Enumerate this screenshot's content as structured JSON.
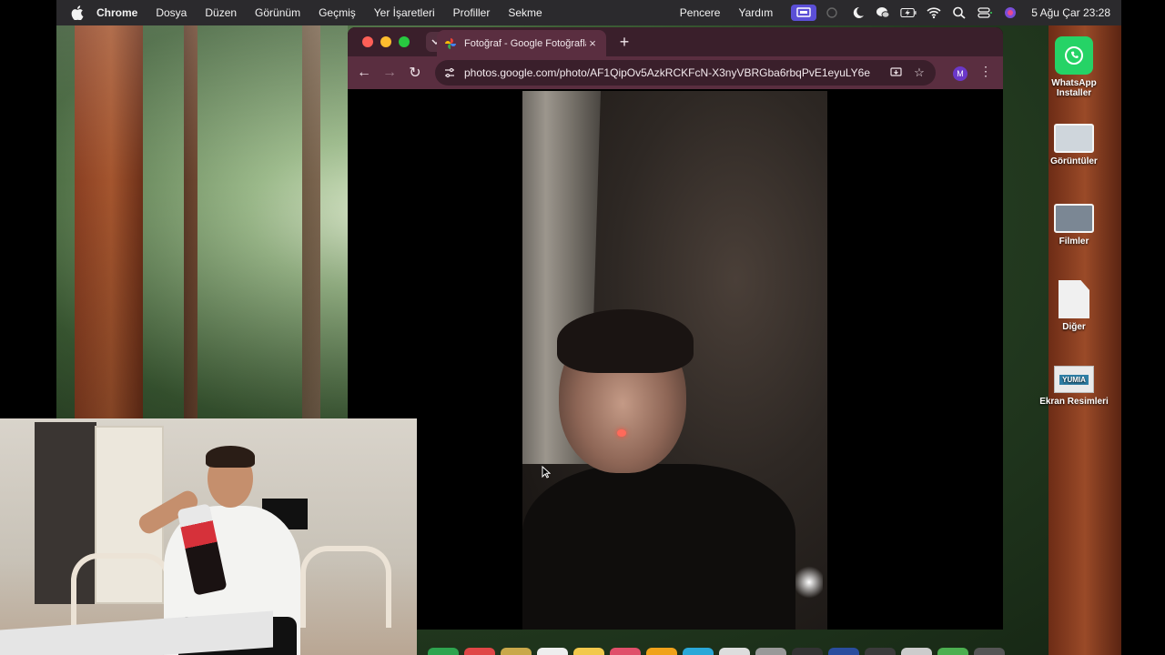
{
  "menubar": {
    "app_name": "Chrome",
    "menus": [
      "Dosya",
      "Düzen",
      "Görünüm",
      "Geçmiş",
      "Yer İşaretleri",
      "Profiller",
      "Sekme"
    ],
    "right_menus": [
      "Pencere",
      "Yardım"
    ],
    "clock": "5 Ağu Çar  23:28",
    "icons": [
      "screen-mirroring-icon",
      "focus-moon-icon",
      "wechat-icon",
      "battery-charging-icon",
      "wifi-icon",
      "spotlight-search-icon",
      "control-center-icon",
      "siri-icon"
    ]
  },
  "browser": {
    "tab": {
      "title": "Fotoğraf - Google Fotoğraflar",
      "close_glyph": "×"
    },
    "new_tab_glyph": "+",
    "url": "photos.google.com/photo/AF1QipOv5AzkRCKFcN-X3nyVBRGba6rbqPvE1eyuLY6e",
    "profile_initial": "M",
    "back_glyph": "←",
    "forward_glyph": "→",
    "reload_glyph": "↻",
    "menu_glyph": "⋮",
    "star_glyph": "☆"
  },
  "desktop": {
    "icons": [
      {
        "label": "WhatsApp Installer"
      },
      {
        "label": "Görüntüler"
      },
      {
        "label": "Filmler"
      },
      {
        "label": "Diğer"
      },
      {
        "label": "Ekran Resimleri"
      }
    ],
    "yumia_text": "YUMIA"
  },
  "colors": {
    "menubar": "#2b2a2d",
    "tabbar": "#3a1f2b",
    "toolbar": "#5a2e40",
    "accent_profile": "#6b38c9",
    "whatsapp": "#25d366"
  },
  "dock": {
    "item_colors": [
      "#2ea44f",
      "#e04646",
      "#c9a84a",
      "#eeeeee",
      "#f2c94c",
      "#e04f6a",
      "#f0a21a",
      "#2aa8d8",
      "#dddddd",
      "#999999",
      "#333333",
      "#2a4d9e",
      "#3b3b3b",
      "#cccccc",
      "#4caf50",
      "#555555"
    ]
  }
}
